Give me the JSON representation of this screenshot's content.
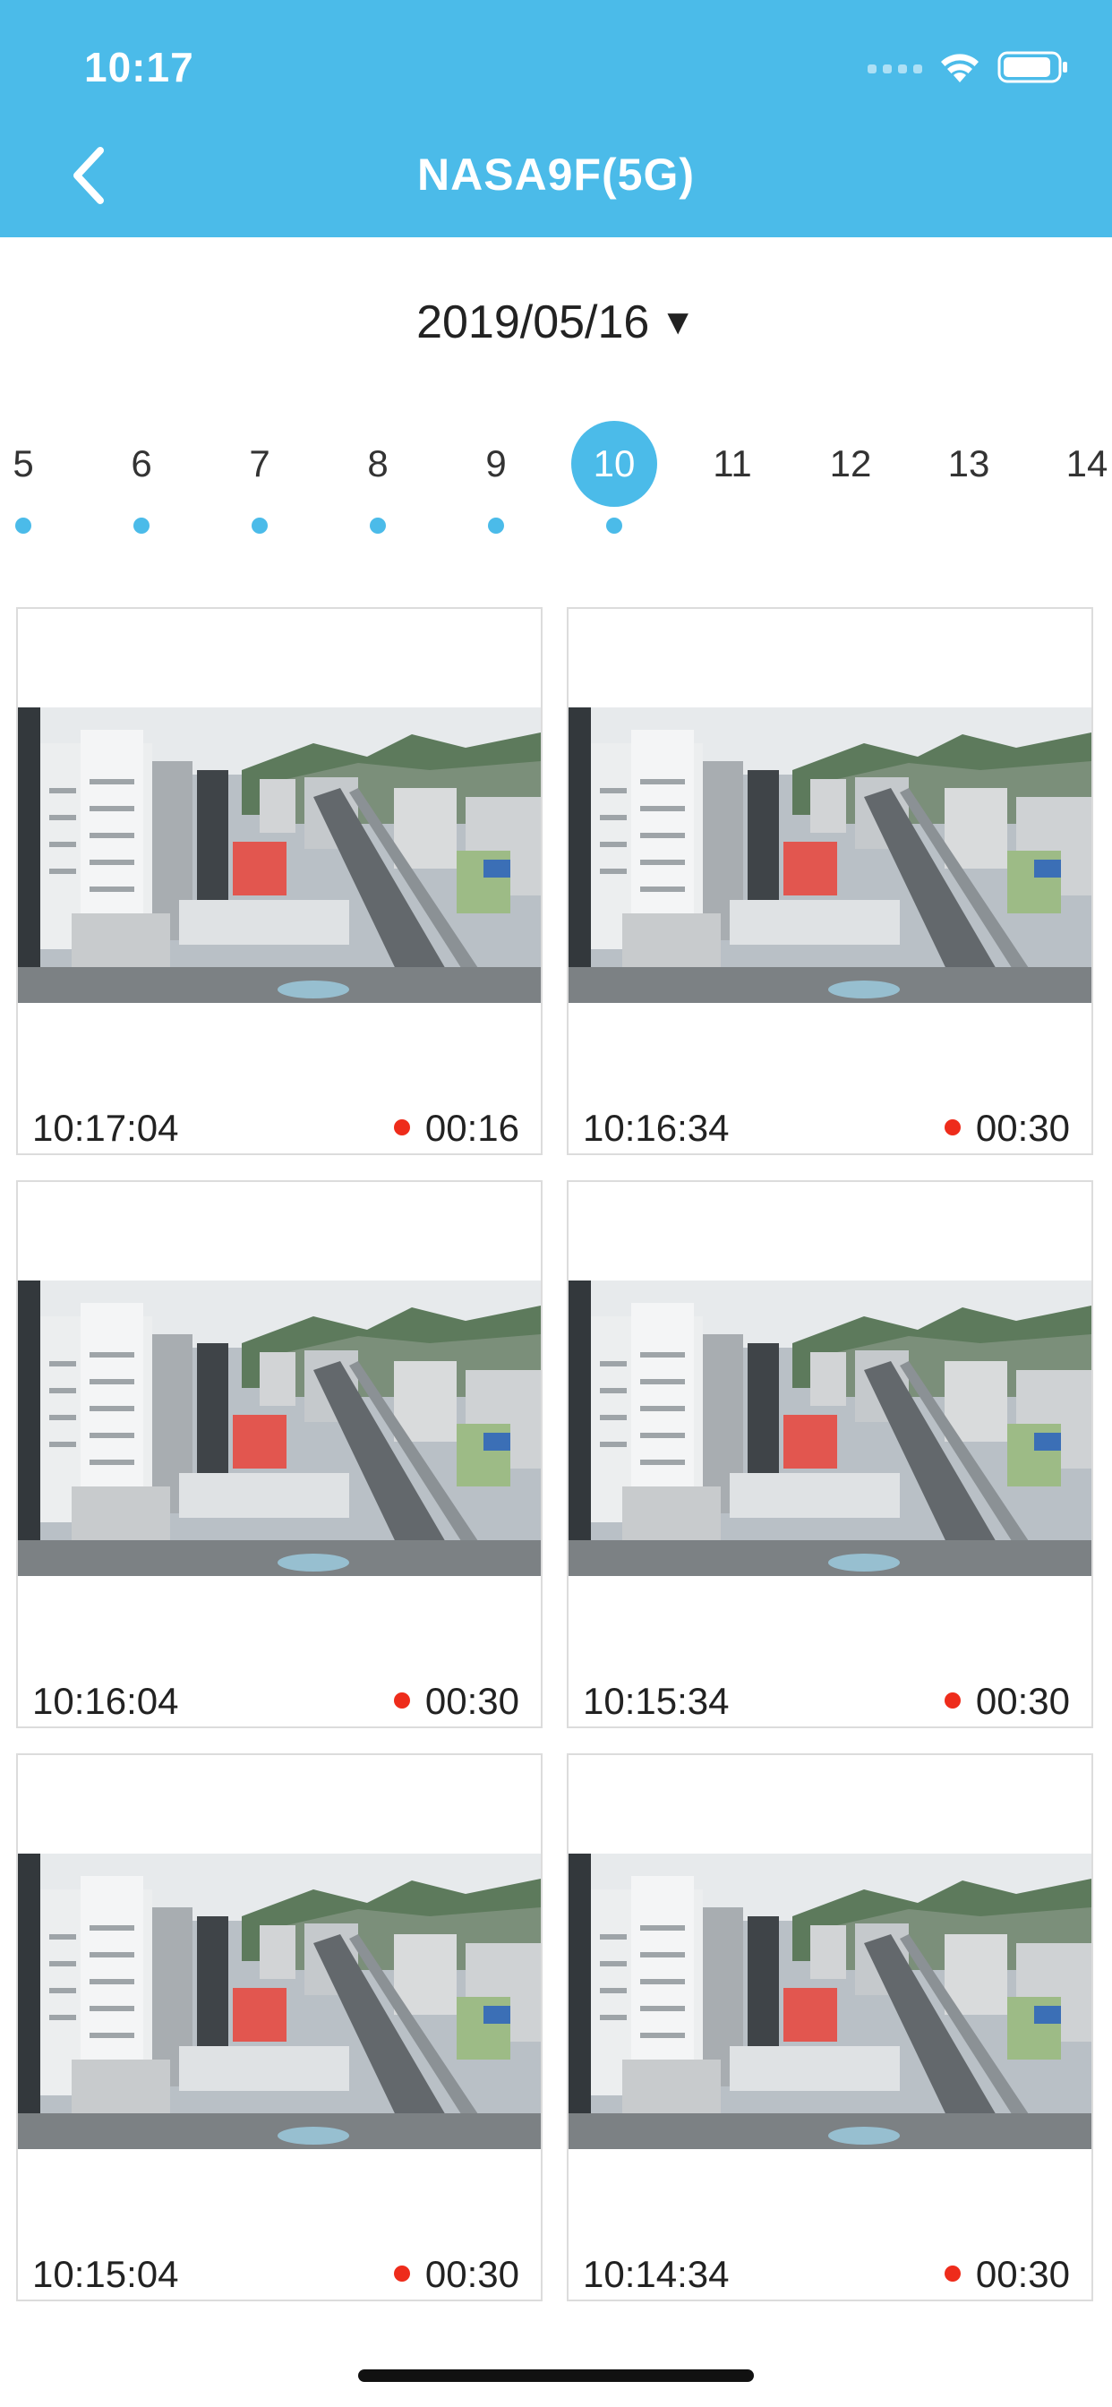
{
  "status_bar": {
    "time": "10:17",
    "icons": [
      "cellular-signal-icon",
      "wifi-icon",
      "battery-icon"
    ]
  },
  "nav": {
    "back_icon": "chevron-left-icon",
    "title": "NASA9F(5G)"
  },
  "date_selector": {
    "date": "2019/05/16",
    "caret": "▼"
  },
  "day_strip": {
    "days": [
      "5",
      "6",
      "7",
      "8",
      "9",
      "10",
      "11",
      "12",
      "13",
      "14"
    ],
    "selected": "10",
    "days_with_recordings": [
      "5",
      "6",
      "7",
      "8",
      "9",
      "10"
    ]
  },
  "recordings": [
    {
      "time": "10:17:04",
      "duration": "00:16"
    },
    {
      "time": "10:16:34",
      "duration": "00:30"
    },
    {
      "time": "10:16:04",
      "duration": "00:30"
    },
    {
      "time": "10:15:34",
      "duration": "00:30"
    },
    {
      "time": "10:15:04",
      "duration": "00:30"
    },
    {
      "time": "10:14:34",
      "duration": "00:30"
    }
  ],
  "colors": {
    "accent": "#4bbbe9",
    "recording_dot": "#ee2c1b"
  }
}
